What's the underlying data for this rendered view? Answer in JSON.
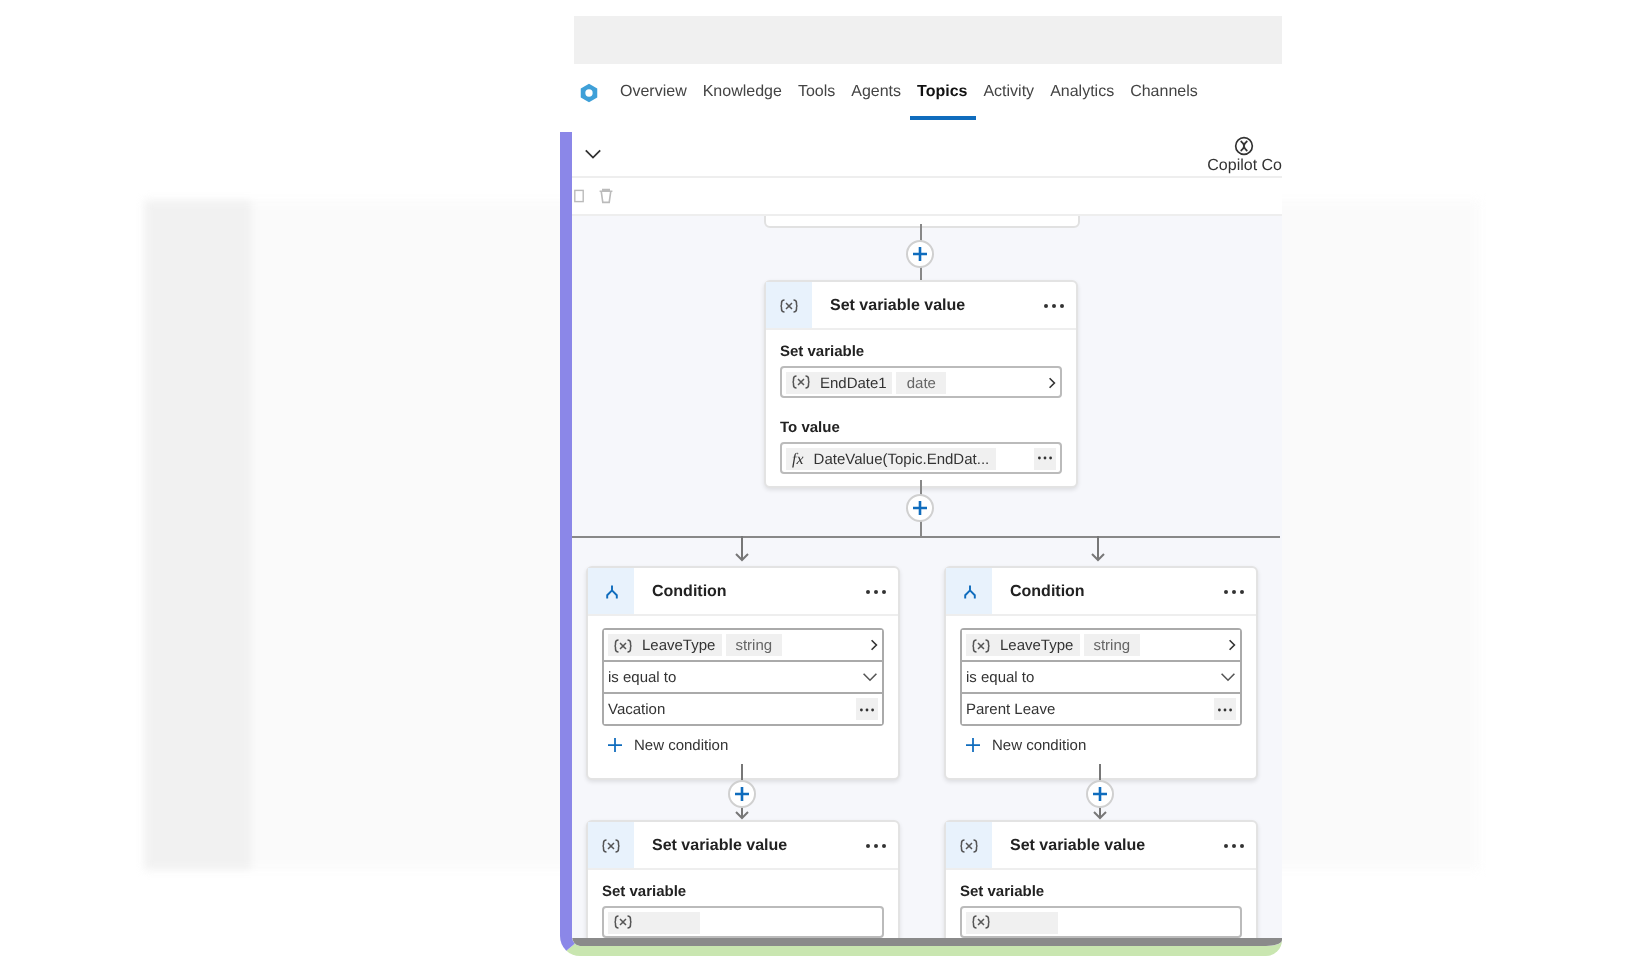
{
  "nav": {
    "tabs": [
      {
        "label": "Overview",
        "selected": false
      },
      {
        "label": "Knowledge",
        "selected": false
      },
      {
        "label": "Tools",
        "selected": false
      },
      {
        "label": "Agents",
        "selected": false
      },
      {
        "label": "Topics",
        "selected": true
      },
      {
        "label": "Activity",
        "selected": false
      },
      {
        "label": "Analytics",
        "selected": false
      },
      {
        "label": "Channels",
        "selected": false
      }
    ]
  },
  "panel": {
    "copilot_label": "Copilot Co"
  },
  "set_variable_node": {
    "title": "Set variable value",
    "set_label": "Set variable",
    "variable": "EndDate1",
    "type": "date",
    "value_label": "To value",
    "fx": "fx",
    "formula": "DateValue(Topic.EndDat..."
  },
  "conditions": [
    {
      "title": "Condition",
      "variable": "LeaveType",
      "type": "string",
      "operator": "is equal to",
      "value": "Vacation",
      "add": "New condition"
    },
    {
      "title": "Condition",
      "variable": "LeaveType",
      "type": "string",
      "operator": "is equal to",
      "value": "Parent Leave",
      "add": "New condition"
    }
  ],
  "bottom_nodes": [
    {
      "title": "Set variable value",
      "set_label": "Set variable"
    },
    {
      "title": "Set variable value",
      "set_label": "Set variable"
    }
  ]
}
